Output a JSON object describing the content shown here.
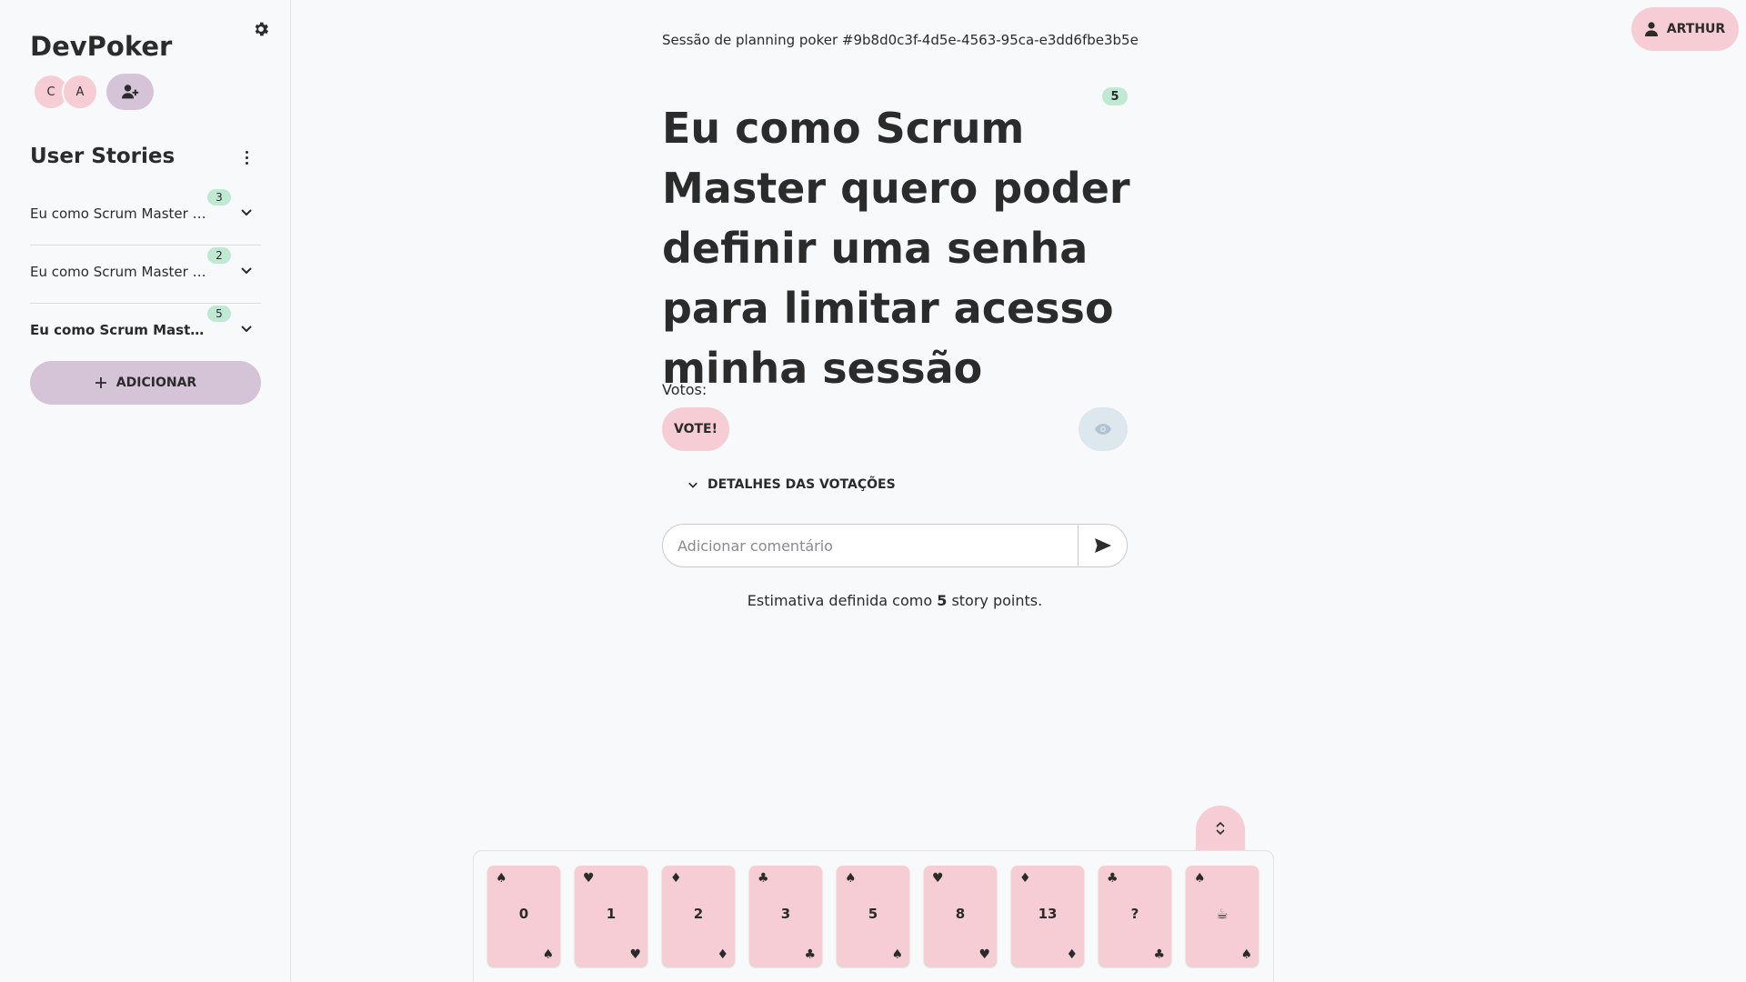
{
  "app": {
    "title": "DevPoker"
  },
  "participants": [
    {
      "initial": "C"
    },
    {
      "initial": "A"
    }
  ],
  "sidebar": {
    "stories_title": "User Stories",
    "stories": [
      {
        "title": "Eu como Scrum Master q...",
        "points": "3",
        "active": false
      },
      {
        "title": "Eu como Scrum Master q...",
        "points": "2",
        "active": false
      },
      {
        "title": "Eu como Scrum Master ...",
        "points": "5",
        "active": true
      }
    ],
    "add_label": "ADICIONAR"
  },
  "header": {
    "session": "Sessão de planning poker #9b8d0c3f-4d5e-4563-95ca-e3dd6fbe3b5e",
    "user_label": "ARTHUR"
  },
  "main": {
    "points_badge": "5",
    "story_title": "Eu como Scrum Master quero poder definir uma senha para limitar acesso minha sessão",
    "votes_label": "Votos:",
    "vote_button": "VOTE!",
    "details_label": "DETALHES DAS VOTAÇÕES",
    "comment_placeholder": "Adicionar comentário",
    "estimate_prefix": "Estimativa definida como",
    "estimate_value": "5",
    "estimate_suffix": "story points."
  },
  "cards": [
    {
      "value": "0",
      "suit": "♠"
    },
    {
      "value": "1",
      "suit": "♥"
    },
    {
      "value": "2",
      "suit": "♦"
    },
    {
      "value": "3",
      "suit": "♣"
    },
    {
      "value": "5",
      "suit": "♠"
    },
    {
      "value": "8",
      "suit": "♥"
    },
    {
      "value": "13",
      "suit": "♦"
    },
    {
      "value": "?",
      "suit": "♣"
    },
    {
      "value": "☕",
      "suit": "♠"
    }
  ],
  "colors": {
    "pink": "#f6cdd4",
    "lavender": "#d5c3d8",
    "mint": "#bfe9d3",
    "text": "#2b2b2b"
  }
}
